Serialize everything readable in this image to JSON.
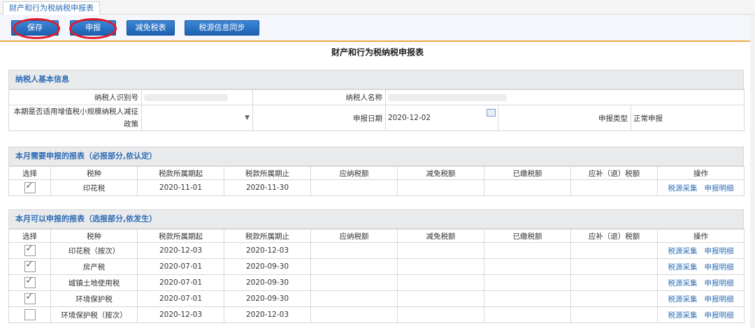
{
  "tab": {
    "label": "财产和行为税纳税申报表"
  },
  "toolbar": {
    "save": "保存",
    "submit": "申报",
    "relief": "减免税表",
    "sync": "税源信息同步"
  },
  "title": "财产和行为税纳税申报表",
  "basic": {
    "header": "纳税人基本信息",
    "taxpayer_id_label": "纳税人识别号",
    "taxpayer_name_label": "纳税人名称",
    "policy_label": "本期是否适用增值税小规模纳税人减征政策",
    "declare_date_label": "申报日期",
    "declare_date": "2020-12-02",
    "declare_type_label": "申报类型",
    "declare_type": "正常申报"
  },
  "columns": {
    "select": "选择",
    "tax_type": "税种",
    "period_start": "税款所属期起",
    "period_end": "税款所属期止",
    "payable": "应纳税额",
    "relief": "减免税额",
    "paid": "已缴税额",
    "refund": "应补（退）税额",
    "ops": "操作"
  },
  "ops": {
    "collect": "税源采集",
    "detail": "申报明细"
  },
  "required": {
    "header": "本月需要申报的报表（必报部分,依认定）",
    "rows": [
      {
        "tax": "印花税",
        "start": "2020-11-01",
        "end": "2020-11-30",
        "checked": true
      }
    ]
  },
  "optional": {
    "header": "本月可以申报的报表（选报部分,依发生）",
    "rows": [
      {
        "tax": "印花税（按次）",
        "start": "2020-12-03",
        "end": "2020-12-03",
        "checked": true
      },
      {
        "tax": "房产税",
        "start": "2020-07-01",
        "end": "2020-09-30",
        "checked": true
      },
      {
        "tax": "城镇土地使用税",
        "start": "2020-07-01",
        "end": "2020-09-30",
        "checked": true
      },
      {
        "tax": "环境保护税",
        "start": "2020-07-01",
        "end": "2020-09-30",
        "checked": true
      },
      {
        "tax": "环境保护税（按次）",
        "start": "2020-12-03",
        "end": "2020-12-03",
        "checked": false
      }
    ]
  },
  "colors": {
    "accent": "#2e6db5",
    "highlight_ring": "#e11a2c",
    "toolbar_line": "#f0a84a"
  }
}
